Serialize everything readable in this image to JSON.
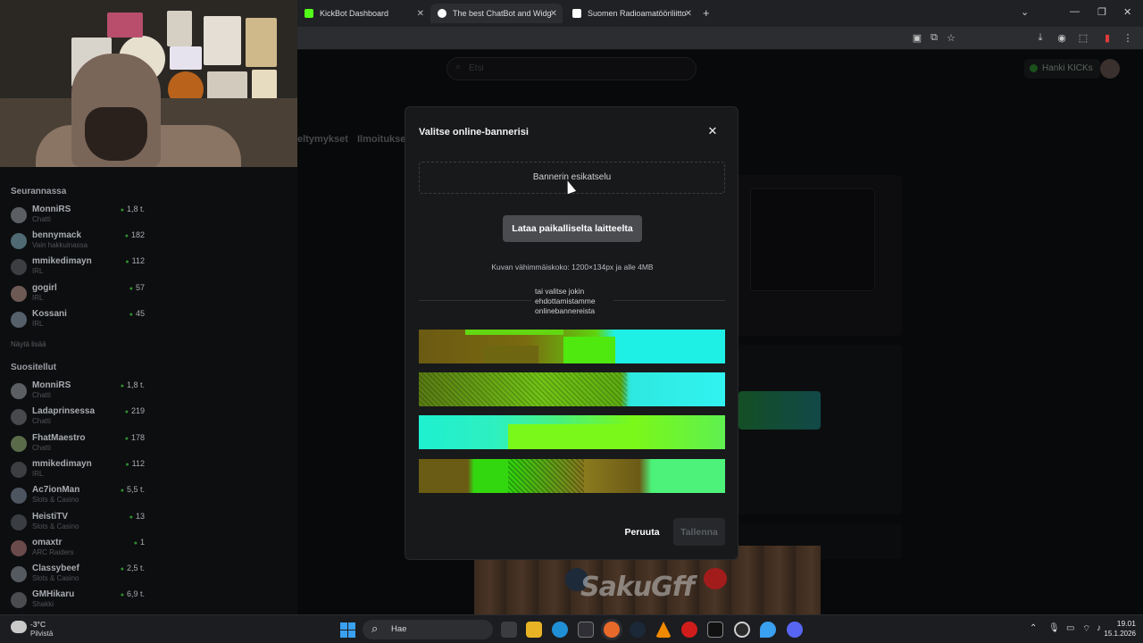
{
  "browser": {
    "tabs": [
      {
        "title": "KickBot Dashboard",
        "favicon_color": "#53fc18"
      },
      {
        "title": "The best ChatBot and Widgets",
        "favicon_color": "#ffffff"
      },
      {
        "title": "Suomen Radioamatööriliitto",
        "favicon_color": "#ffffff"
      }
    ],
    "new_tab_icon": "plus-icon"
  },
  "page": {
    "search_placeholder": "Etsi",
    "get_kicks_label": "Hanki KICKs",
    "nav_partial_1": "eltymykset",
    "nav_partial_2": "Ilmoitukse"
  },
  "sidebar": {
    "following_heading": "Seurannassa",
    "following": [
      {
        "name": "MonniRS",
        "category": "Chatti",
        "viewers": "1,8 t."
      },
      {
        "name": "bennymack",
        "category": "Vain hakkuinassa",
        "viewers": "182"
      },
      {
        "name": "mmikedimayn",
        "category": "IRL",
        "viewers": "112"
      },
      {
        "name": "gogirl",
        "category": "IRL",
        "viewers": "57"
      },
      {
        "name": "Kossani",
        "category": "IRL",
        "viewers": "45"
      }
    ],
    "show_more": "Näytä lisää",
    "recommended_heading": "Suositellut",
    "recommended": [
      {
        "name": "MonniRS",
        "category": "Chatti",
        "viewers": "1,8 t."
      },
      {
        "name": "Ladaprinsessa",
        "category": "Chatti",
        "viewers": "219"
      },
      {
        "name": "FhatMaestro",
        "category": "Chatti",
        "viewers": "178"
      },
      {
        "name": "mmikedimayn",
        "category": "IRL",
        "viewers": "112"
      },
      {
        "name": "Ac7ionMan",
        "category": "Slots & Casino",
        "viewers": "5,5 t."
      },
      {
        "name": "HeistiTV",
        "category": "Slots & Casino",
        "viewers": "13"
      },
      {
        "name": "omaxtr",
        "category": "ARC Raiders",
        "viewers": "1"
      },
      {
        "name": "Classybeef",
        "category": "Slots & Casino",
        "viewers": "2,5 t."
      },
      {
        "name": "GMHikaru",
        "category": "Shakki",
        "viewers": "6,9 t."
      }
    ]
  },
  "modal": {
    "title": "Valitse online-bannerisi",
    "close_icon": "close-icon",
    "preview_label": "Bannerin esikatselu",
    "upload_button": "Lataa paikalliselta laitteelta",
    "min_size_text": "Kuvan vähimmäiskoko: 1200×134px ja alle 4MB",
    "or_text": "tai valitse jokin ehdottamistamme onlinebannereista",
    "banners": [
      {
        "colors": [
          "#6b5a12",
          "#7a6a10",
          "#5fd40f",
          "#1ff0e6"
        ]
      },
      {
        "colors": [
          "#5a7d14",
          "#74c816",
          "#2ee8e0",
          "#31f3f0"
        ]
      },
      {
        "colors": [
          "#1ef0d0",
          "#48f080",
          "#7af818",
          "#5ff050"
        ]
      },
      {
        "colors": [
          "#6a5c14",
          "#33d70f",
          "#8a7a1e",
          "#4df27a"
        ]
      }
    ],
    "cancel_button": "Peruuta",
    "save_button": "Tallenna"
  },
  "stream": {
    "logo_text": "SakuGff"
  },
  "taskbar": {
    "weather_temp": "-3°C",
    "weather_desc": "Pilvistä",
    "search_label": "Hae",
    "time": "19.01",
    "date": "15.1.2026",
    "start_icon": "windows-start-icon"
  }
}
